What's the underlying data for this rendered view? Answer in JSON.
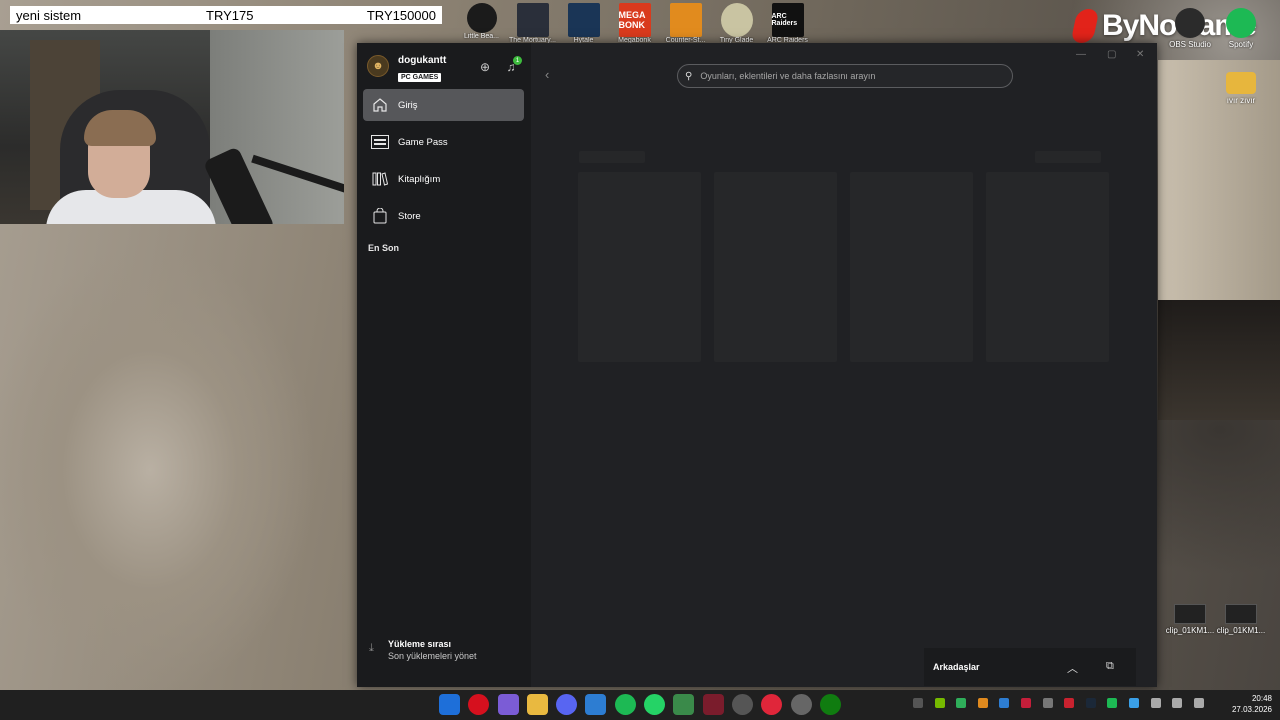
{
  "overlay": {
    "name": "yeni sistem",
    "goal_current": "TRY175",
    "goal_target": "TRY150000"
  },
  "desktop": {
    "top_icons": [
      {
        "label": "Little Bea...",
        "icon": "game-icon"
      },
      {
        "label": "The Mortuary...",
        "icon": "game-icon"
      },
      {
        "label": "Hytale",
        "icon": "game-icon"
      },
      {
        "label": "Megabonk",
        "icon": "game-icon",
        "tile_text": "MEGA BONK"
      },
      {
        "label": "Counter-St...",
        "icon": "game-icon"
      },
      {
        "label": "Tiny Glade",
        "icon": "game-icon"
      },
      {
        "label": "ARC Raiders",
        "icon": "game-icon",
        "tile_text": "ARC Raiders"
      }
    ],
    "obs_label": "OBS Studio",
    "spotify_label": "Spotify",
    "folder_label": "ıvır zıvır",
    "clips": [
      "clip_01KM1...",
      "clip_01KM1..."
    ],
    "watermark": "ByNoGame"
  },
  "xbox": {
    "profile": {
      "username": "dogukantt",
      "badge": "PC GAMES"
    },
    "notifications_count": "1",
    "nav": [
      {
        "label": "Giriş",
        "icon": "home-icon",
        "active": true
      },
      {
        "label": "Game Pass",
        "icon": "game-pass-icon",
        "active": false
      },
      {
        "label": "Kitaplığım",
        "icon": "library-icon",
        "active": false
      },
      {
        "label": "Store",
        "icon": "store-icon",
        "active": false
      }
    ],
    "section_recent": "En Son",
    "install_queue": {
      "title": "Yükleme sırası",
      "subtitle": "Son yüklemeleri yönet"
    },
    "search": {
      "placeholder": "Oyunları, eklentileri ve daha fazlasını arayın"
    },
    "friends": {
      "label": "Arkadaşlar"
    }
  },
  "taskbar": {
    "time": "20:48",
    "date": "27.03.2026"
  }
}
